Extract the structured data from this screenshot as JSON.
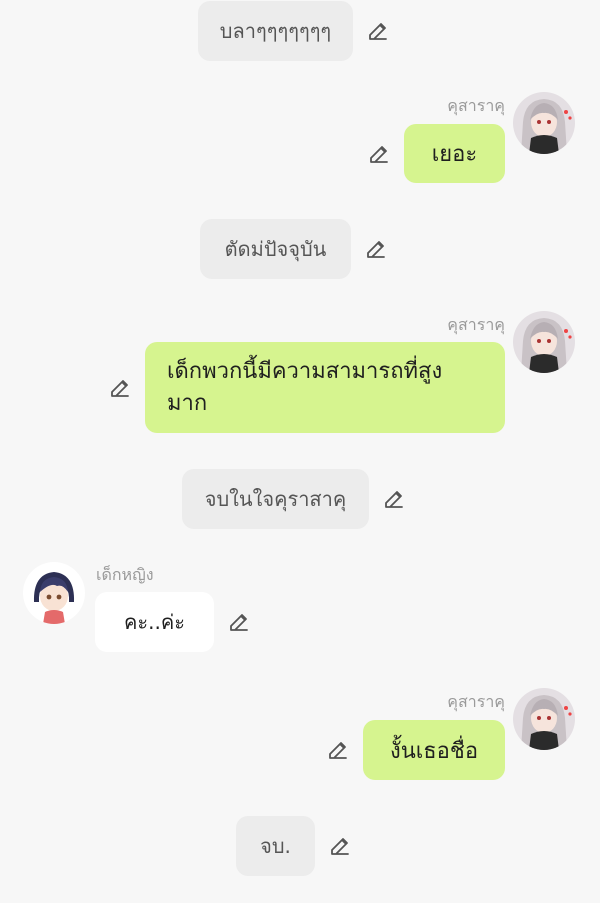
{
  "messages": [
    {
      "type": "narration",
      "text": "บลาๆๆๆๆๆๆๆ"
    },
    {
      "type": "right",
      "name": "คุสาราคุ",
      "text": "เยอะ",
      "avatar_icon": "gray-haired-girl-avatar"
    },
    {
      "type": "narration",
      "text": "ตัดม่ปัจจุบัน"
    },
    {
      "type": "right",
      "name": "คุสาราคุ",
      "text": "เด็กพวกนี้มีความสามารถที่สูงมาก",
      "avatar_icon": "gray-haired-girl-avatar"
    },
    {
      "type": "narration",
      "text": "จบในใจคุราสาคุ"
    },
    {
      "type": "left",
      "name": "เด็กหญิง",
      "text": "คะ..ค่ะ",
      "avatar_icon": "dark-haired-girl-avatar"
    },
    {
      "type": "right",
      "name": "คุสาราคุ",
      "text": "งั้นเธอชื่อ",
      "avatar_icon": "gray-haired-girl-avatar"
    },
    {
      "type": "narration",
      "text": "จบ."
    }
  ],
  "colors": {
    "background": "#f7f7f7",
    "narration_bubble": "#ececec",
    "right_bubble": "#d6f48f",
    "left_bubble": "#ffffff",
    "name_text": "#9a9a9a"
  },
  "icons": {
    "edit": "pencil-edit-icon"
  }
}
